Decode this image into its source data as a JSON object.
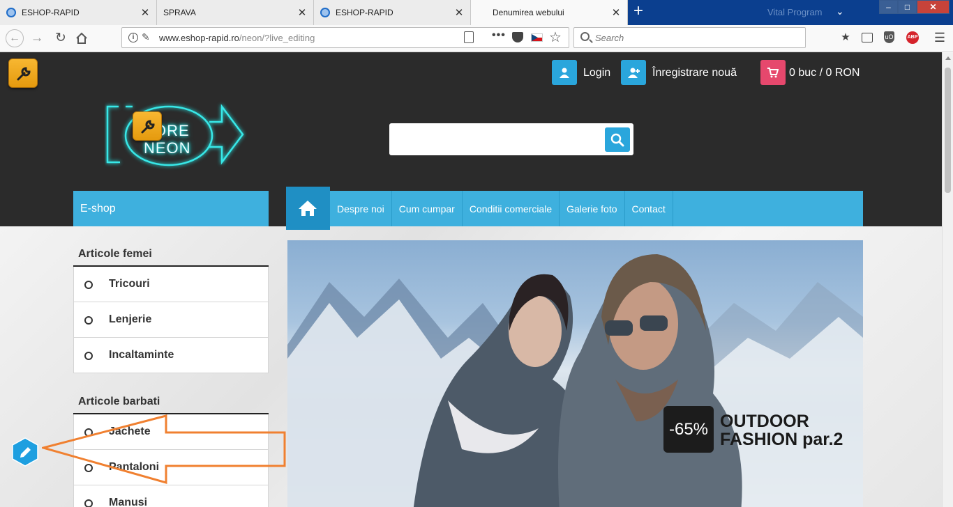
{
  "browser": {
    "tabs": [
      {
        "label": "ESHOP-RAPID",
        "close": "✕"
      },
      {
        "label": "SPRAVA",
        "close": "✕"
      },
      {
        "label": "ESHOP-RAPID",
        "close": "✕"
      },
      {
        "label": "Denumirea webului",
        "close": "✕"
      }
    ],
    "new_tab": "+",
    "window_title": "Vital Program",
    "url_host": "www.eshop-rapid.ro",
    "url_path": "/neon/?live_editing",
    "search_placeholder": "Search",
    "icons": {
      "back": "arrow-left-icon",
      "forward": "arrow-right-icon",
      "reload": "reload-icon",
      "home": "home-icon",
      "bookmark": "star-icon",
      "menu": "hamburger-menu-icon"
    },
    "toolbar": {
      "ublock": "uO",
      "abp": "ABP"
    }
  },
  "header": {
    "login": "Login",
    "register": "Înregistrare nouă",
    "cart": "0 buc / 0 RON",
    "logo_line1": "ORE",
    "logo_line2": "NEON",
    "colors": {
      "login": "#2aa6dc",
      "register": "#2aa6dc",
      "cart": "#e6486d",
      "header_bg": "#2b2b2b"
    }
  },
  "nav": {
    "eshop_label": "E-shop",
    "items": [
      "Despre noi",
      "Cum cumpar",
      "Conditii comerciale",
      "Galerie foto",
      "Contact"
    ],
    "accent": "#3eb0de"
  },
  "sidebar": {
    "groups": [
      {
        "title": "Articole femei",
        "items": [
          "Tricouri",
          "Lenjerie",
          "Incaltaminte"
        ]
      },
      {
        "title": "Articole barbati",
        "items": [
          "Jachete",
          "Pantaloni",
          "Manusi"
        ]
      }
    ]
  },
  "banner": {
    "discount": "-65%",
    "line1": "OUTDOOR",
    "line2": "FASHION par.2"
  },
  "annotation": {
    "arrow_color": "#f08030"
  }
}
